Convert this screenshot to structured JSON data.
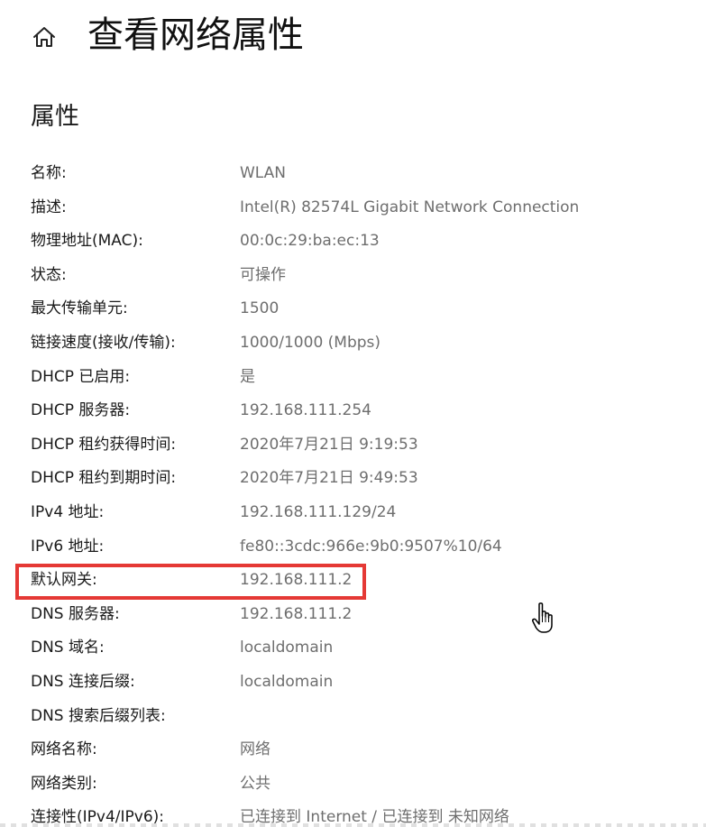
{
  "header": {
    "home_icon": "home-icon",
    "title": "查看网络属性"
  },
  "section": {
    "title": "属性"
  },
  "properties": [
    {
      "label": "名称:",
      "value": "WLAN"
    },
    {
      "label": "描述:",
      "value": "Intel(R) 82574L Gigabit Network Connection"
    },
    {
      "label": "物理地址(MAC):",
      "value": "00:0c:29:ba:ec:13"
    },
    {
      "label": "状态:",
      "value": "可操作"
    },
    {
      "label": "最大传输单元:",
      "value": "1500"
    },
    {
      "label": "链接速度(接收/传输):",
      "value": "1000/1000 (Mbps)"
    },
    {
      "label": "DHCP 已启用:",
      "value": "是"
    },
    {
      "label": "DHCP 服务器:",
      "value": "192.168.111.254"
    },
    {
      "label": "DHCP 租约获得时间:",
      "value": "2020年7月21日 9:19:53"
    },
    {
      "label": "DHCP 租约到期时间:",
      "value": "2020年7月21日 9:49:53"
    },
    {
      "label": "IPv4 地址:",
      "value": "192.168.111.129/24"
    },
    {
      "label": "IPv6 地址:",
      "value": "fe80::3cdc:966e:9b0:9507%10/64"
    },
    {
      "label": "默认网关:",
      "value": "192.168.111.2"
    },
    {
      "label": "DNS 服务器:",
      "value": "192.168.111.2"
    },
    {
      "label": "DNS 域名:",
      "value": "localdomain"
    },
    {
      "label": "DNS 连接后缀:",
      "value": "localdomain"
    },
    {
      "label": "DNS 搜索后缀列表:",
      "value": ""
    },
    {
      "label": "网络名称:",
      "value": "网络"
    },
    {
      "label": "网络类别:",
      "value": "公共"
    },
    {
      "label": "连接性(IPv4/IPv6):",
      "value": "已连接到 Internet / 已连接到 未知网络"
    }
  ],
  "annotation": {
    "highlight_color": "#e53935"
  },
  "cursor": {
    "icon": "hand-pointer-cursor-icon"
  }
}
